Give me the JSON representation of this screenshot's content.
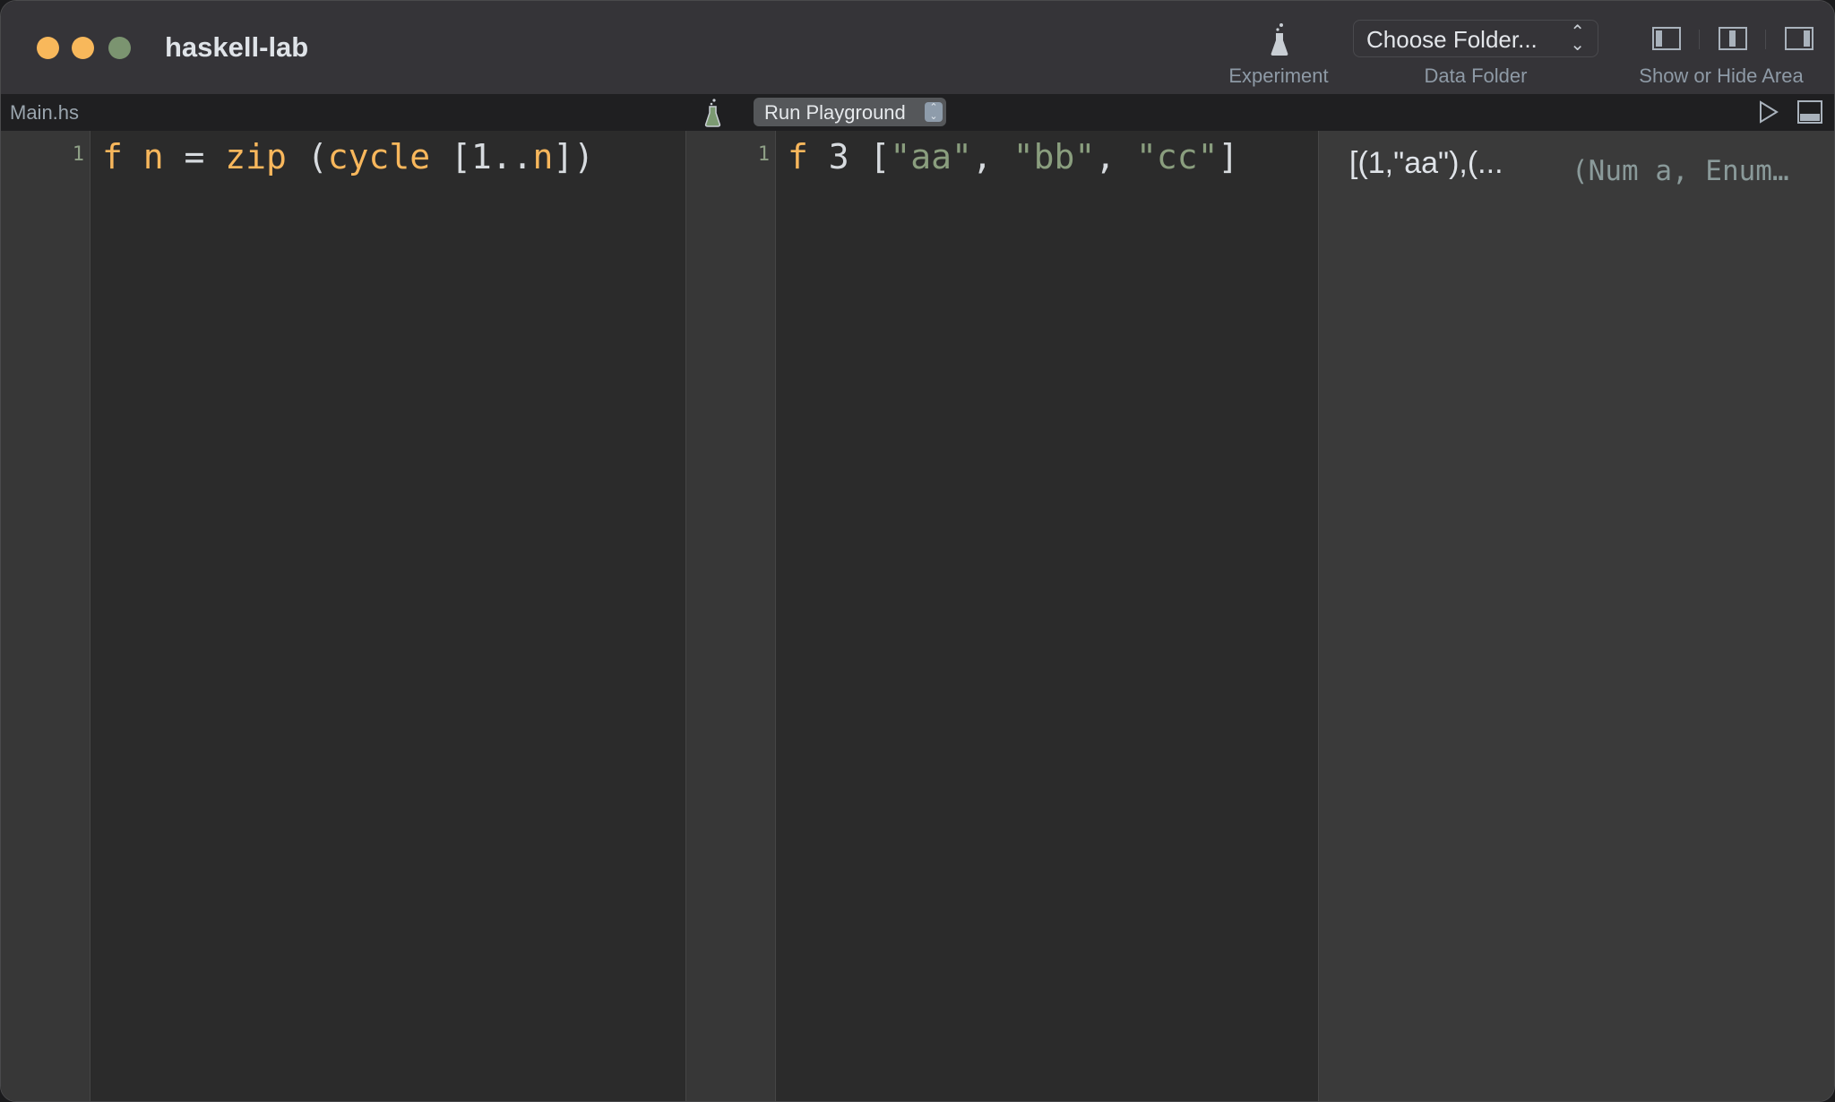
{
  "window": {
    "title": "haskell-lab",
    "traffic_lights": [
      "#f8b85b",
      "#f8b85b",
      "#7b9470"
    ]
  },
  "toolbar": {
    "experiment_label": "Experiment",
    "data_folder_select": "Choose Folder...",
    "data_folder_label": "Data Folder",
    "area_label": "Show or Hide Area"
  },
  "left_editor": {
    "tab": "Main.hs",
    "line_number": "1",
    "tokens": [
      {
        "t": "f n ",
        "c": "o"
      },
      {
        "t": "=",
        "c": "w"
      },
      {
        "t": " zip ",
        "c": "o"
      },
      {
        "t": "(",
        "c": "w"
      },
      {
        "t": "cycle ",
        "c": "o"
      },
      {
        "t": "[1..",
        "c": "w"
      },
      {
        "t": "n",
        "c": "o"
      },
      {
        "t": "])",
        "c": "w"
      }
    ]
  },
  "playground": {
    "run_button": "Run Playground",
    "line_number": "1",
    "tokens": [
      {
        "t": "f ",
        "c": "o"
      },
      {
        "t": "3 [",
        "c": "w"
      },
      {
        "t": "\"aa\"",
        "c": "g"
      },
      {
        "t": ", ",
        "c": "w"
      },
      {
        "t": "\"bb\"",
        "c": "g"
      },
      {
        "t": ", ",
        "c": "w"
      },
      {
        "t": "\"cc\"",
        "c": "g"
      },
      {
        "t": "]",
        "c": "w"
      }
    ]
  },
  "result": {
    "value": "[(1,\"aa\"),(...",
    "type": "(Num a, Enum…"
  }
}
